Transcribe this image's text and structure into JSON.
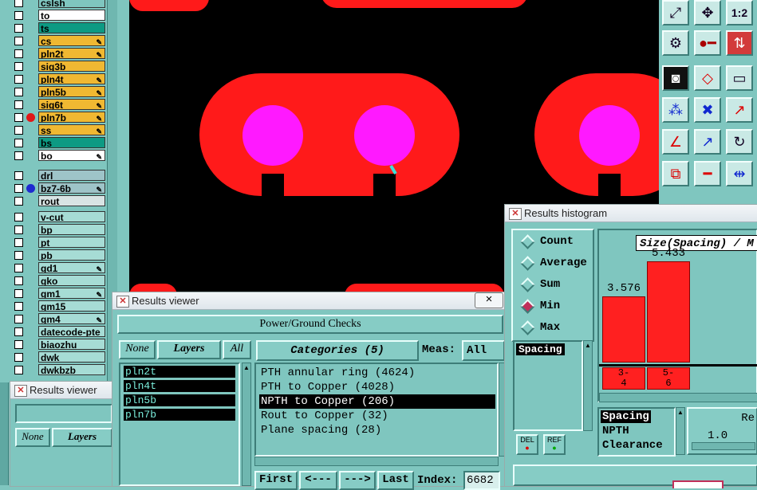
{
  "layers_group1": [
    {
      "name": "cslsh",
      "color": "#7fc6bf",
      "dot": "",
      "lock": false
    },
    {
      "name": "to",
      "color": "#ffffff",
      "dot": "",
      "lock": false
    },
    {
      "name": "ts",
      "color": "#0d9a83",
      "dot": "",
      "lock": false
    },
    {
      "name": "cs",
      "color": "#f0b832",
      "dot": "",
      "lock": true
    },
    {
      "name": "pln2t",
      "color": "#f0b832",
      "dot": "",
      "lock": true
    },
    {
      "name": "sig3b",
      "color": "#f0b832",
      "dot": "",
      "lock": false
    },
    {
      "name": "pln4t",
      "color": "#f0b832",
      "dot": "",
      "lock": true
    },
    {
      "name": "pln5b",
      "color": "#f0b832",
      "dot": "",
      "lock": true
    },
    {
      "name": "sig6t",
      "color": "#f0b832",
      "dot": "",
      "lock": true
    },
    {
      "name": "pln7b",
      "color": "#f0b832",
      "dot": "#e01818",
      "lock": true
    },
    {
      "name": "ss",
      "color": "#f0b832",
      "dot": "",
      "lock": true
    },
    {
      "name": "bs",
      "color": "#0d9a83",
      "dot": "",
      "lock": false
    },
    {
      "name": "bo",
      "color": "#ffffff",
      "dot": "",
      "lock": true
    }
  ],
  "layers_group2": [
    {
      "name": "drl",
      "color": "#9ec4c8",
      "dot": "",
      "lock": false
    },
    {
      "name": "bz7-6b",
      "color": "#9ec4c8",
      "dot": "#1e2ad0",
      "lock": true
    },
    {
      "name": "rout",
      "color": "#d8e4e4",
      "dot": "",
      "lock": false
    }
  ],
  "layers_group3": [
    {
      "name": "v-cut",
      "color": "#a6dcd5",
      "dot": "",
      "lock": false
    },
    {
      "name": "bp",
      "color": "#a6dcd5",
      "dot": "",
      "lock": false
    },
    {
      "name": "pt",
      "color": "#a6dcd5",
      "dot": "",
      "lock": false
    },
    {
      "name": "pb",
      "color": "#a6dcd5",
      "dot": "",
      "lock": false
    },
    {
      "name": "gd1",
      "color": "#a6dcd5",
      "dot": "",
      "lock": true
    },
    {
      "name": "gko",
      "color": "#a6dcd5",
      "dot": "",
      "lock": false
    },
    {
      "name": "gm1",
      "color": "#a6dcd5",
      "dot": "",
      "lock": true
    },
    {
      "name": "gm15",
      "color": "#a6dcd5",
      "dot": "",
      "lock": false
    },
    {
      "name": "gm4",
      "color": "#a6dcd5",
      "dot": "",
      "lock": true
    },
    {
      "name": "datecode-pte",
      "color": "#a6dcd5",
      "dot": "",
      "lock": false
    },
    {
      "name": "biaozhu",
      "color": "#a6dcd5",
      "dot": "",
      "lock": false
    },
    {
      "name": "dwk",
      "color": "#a6dcd5",
      "dot": "",
      "lock": false
    },
    {
      "name": "dwkbzb",
      "color": "#a6dcd5",
      "dot": "",
      "lock": false
    }
  ],
  "toolbar": {
    "zoom_ratio_label": "1:2"
  },
  "results_viewer_small": {
    "title": "Results viewer",
    "none_label": "None",
    "layers_label": "Layers"
  },
  "results_viewer": {
    "title": "Results viewer",
    "close_label": "×",
    "check_title": "Power/Ground Checks",
    "none_label": "None",
    "layers_label": "Layers",
    "all_label": "All",
    "layers": [
      "pln2t",
      "pln4t",
      "pln5b",
      "pln7b"
    ],
    "categories_label": "Categories (5)",
    "meas_label": "Meas:",
    "meas_value": "All",
    "categories": [
      {
        "text": "PTH annular ring (4624)",
        "selected": false
      },
      {
        "text": "PTH to Copper (4028)",
        "selected": false
      },
      {
        "text": "NPTH to Copper (206)",
        "selected": true
      },
      {
        "text": "Rout to Copper (32)",
        "selected": false
      },
      {
        "text": "Plane spacing (28)",
        "selected": false
      }
    ],
    "first_label": "First",
    "prev_label": "<---",
    "next_label": "--->",
    "last_label": "Last",
    "index_label": "Index:",
    "index_value": "6682"
  },
  "histogram": {
    "title": "Results histogram",
    "modes": [
      {
        "label": "Count",
        "on": false
      },
      {
        "label": "Average",
        "on": false
      },
      {
        "label": "Sum",
        "on": false
      },
      {
        "label": "Min",
        "on": true
      },
      {
        "label": "Max",
        "on": false
      }
    ],
    "measure_list": [
      "Spacing"
    ],
    "del_label": "DEL",
    "ref_label": "REF",
    "chart_title": "Size(Spacing) / M",
    "bins": [
      "3-\n4",
      "5-\n6"
    ],
    "bin_line1": [
      "3-",
      "5-"
    ],
    "bin_line2": [
      "4",
      "6"
    ],
    "values": [
      "3.576",
      "5.433"
    ],
    "bottom_list": [
      "Spacing",
      "NPTH",
      "Clearance"
    ],
    "right_label": "Re",
    "right_value": "1.0",
    "chart_data": {
      "type": "bar",
      "categories": [
        "3-4",
        "5-6"
      ],
      "values": [
        3.576,
        5.433
      ]
    }
  }
}
